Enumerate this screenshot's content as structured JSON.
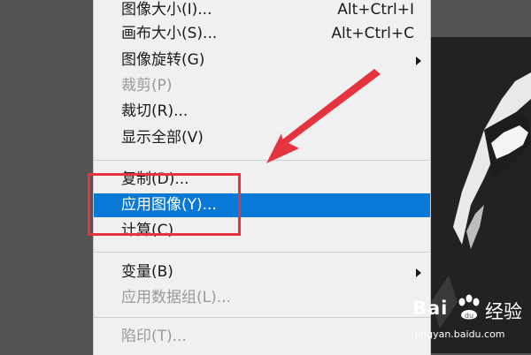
{
  "menu": {
    "items": [
      {
        "label": "图像大小(I)...",
        "shortcut": "Alt+Ctrl+I",
        "enabled": true
      },
      {
        "label": "画布大小(S)...",
        "shortcut": "Alt+Ctrl+C",
        "enabled": true
      },
      {
        "label": "图像旋转(G)",
        "submenu": true,
        "enabled": true
      },
      {
        "label": "裁剪(P)",
        "enabled": false
      },
      {
        "label": "裁切(R)...",
        "enabled": true
      },
      {
        "label": "显示全部(V)",
        "enabled": true
      },
      {
        "label": "复制(D)...",
        "enabled": true
      },
      {
        "label": "应用图像(Y)...",
        "enabled": true,
        "highlighted": true
      },
      {
        "label": "计算(C)",
        "enabled": true
      },
      {
        "label": "变量(B)",
        "submenu": true,
        "enabled": true
      },
      {
        "label": "应用数据组(L)...",
        "enabled": false
      },
      {
        "label": "陷印(T)...",
        "enabled": false
      }
    ]
  },
  "annotation": {
    "color": "#e5343f"
  },
  "watermark": {
    "brand": "Bai",
    "brand_suffix": "经验",
    "paw_text": "du",
    "url": "jingyan.baidu.com"
  },
  "colors": {
    "highlight": "#0a78d7",
    "menu_bg": "#f0f0f0",
    "disabled": "#9a9a9a",
    "annotation": "#e5343f"
  }
}
